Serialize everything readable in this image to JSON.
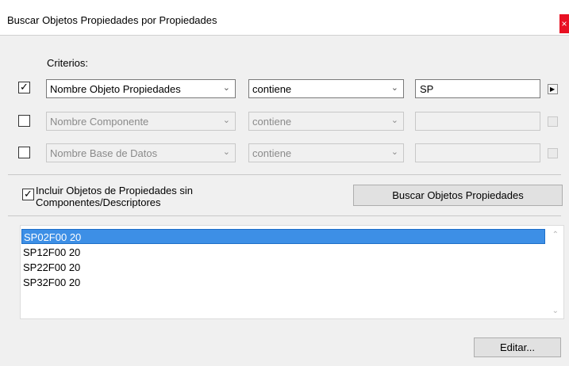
{
  "window": {
    "title": "Buscar Objetos Propiedades por Propiedades",
    "close_glyph": "×"
  },
  "criteria": {
    "label": "Criterios:",
    "rows": [
      {
        "checked": true,
        "check_glyph": "✓",
        "field": "Nombre Objeto Propiedades",
        "operator": "contiene",
        "value": "SP",
        "enabled": true,
        "arrow_icon": "play-triangle-icon"
      },
      {
        "checked": false,
        "check_glyph": "",
        "field": "Nombre Componente",
        "operator": "contiene",
        "value": "",
        "enabled": false
      },
      {
        "checked": false,
        "check_glyph": "",
        "field": "Nombre Base de Datos",
        "operator": "contiene",
        "value": "",
        "enabled": false
      }
    ]
  },
  "include": {
    "checked": true,
    "check_glyph": "✓",
    "label_line1": "Incluir Objetos de Propiedades sin",
    "label_line2": "Componentes/Descriptores"
  },
  "search_button": "Buscar Objetos Propiedades",
  "results": {
    "items": [
      "SP02F00 20",
      "SP12F00 20",
      "SP22F00 20",
      "SP32F00 20"
    ],
    "selected_index": 0
  },
  "edit_button": "Editar...",
  "colors": {
    "selection": "#3d8fe6",
    "close": "#e81123",
    "panel": "#f0f0f0"
  }
}
